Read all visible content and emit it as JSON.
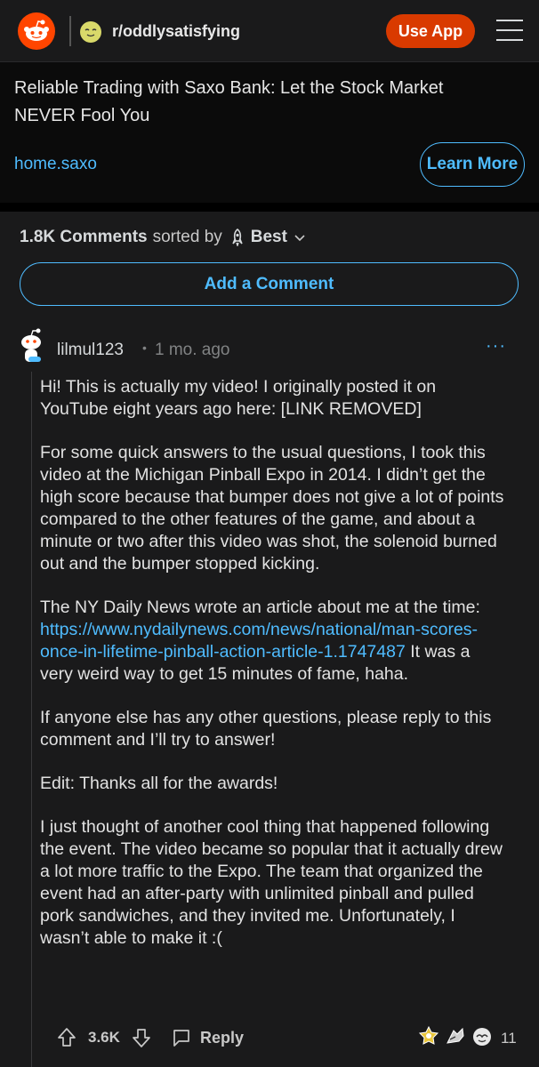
{
  "header": {
    "subreddit": "r/oddlysatisfying",
    "use_app_label": "Use App",
    "icons": [
      "reddit-logo",
      "subreddit-icon",
      "menu-icon"
    ]
  },
  "ad": {
    "title": "Reliable Trading with Saxo Bank: Let the Stock Market NEVER Fool You",
    "domain": "home.saxo",
    "cta": "Learn More"
  },
  "comments_bar": {
    "count": "1.8K Comments",
    "sorted_by": "sorted by",
    "sort": "Best"
  },
  "add_comment_label": "Add a Comment",
  "comment": {
    "author": "lilmul123",
    "dot": "•",
    "time": "1 mo. ago",
    "more": "···",
    "p1": "Hi! This is actually my video! I originally posted it on YouTube eight years ago here: [LINK REMOVED]",
    "p2": "For some quick answers to the usual questions, I took this video at the Michigan Pinball Expo in 2014. I didn’t get the high score because that bumper does not give a lot of points compared to the other features of the game, and about a minute or two after this video was shot, the solenoid burned out and the bumper stopped kicking.",
    "p3_pre": "The NY Daily News wrote an article about me at the time: ",
    "p3_link": "https://www.nydailynews.com/news/national/man-scores-once-in-lifetime-pinball-action-article-1.1747487",
    "p3_post": " It was a very weird way to get 15 minutes of fame, haha.",
    "p4": "If anyone else has any other questions, please reply to this comment and I’ll try to answer!",
    "p5": "Edit: Thanks all for the awards!",
    "p6": "I just thought of another cool thing that happened following the event. The video became so popular that it actually drew a lot more traffic to the Expo. The team that organized the event had an after-party with unlimited pinball and pulled pork sandwiches, and they invited me. Unfortunately, I wasn’t able to make it :(",
    "score": "3.6K",
    "reply_label": "Reply",
    "award_count": "11"
  },
  "colors": {
    "accent": "#4fbcff",
    "brand": "#ff4500",
    "use_app_bg": "#d93a00"
  }
}
